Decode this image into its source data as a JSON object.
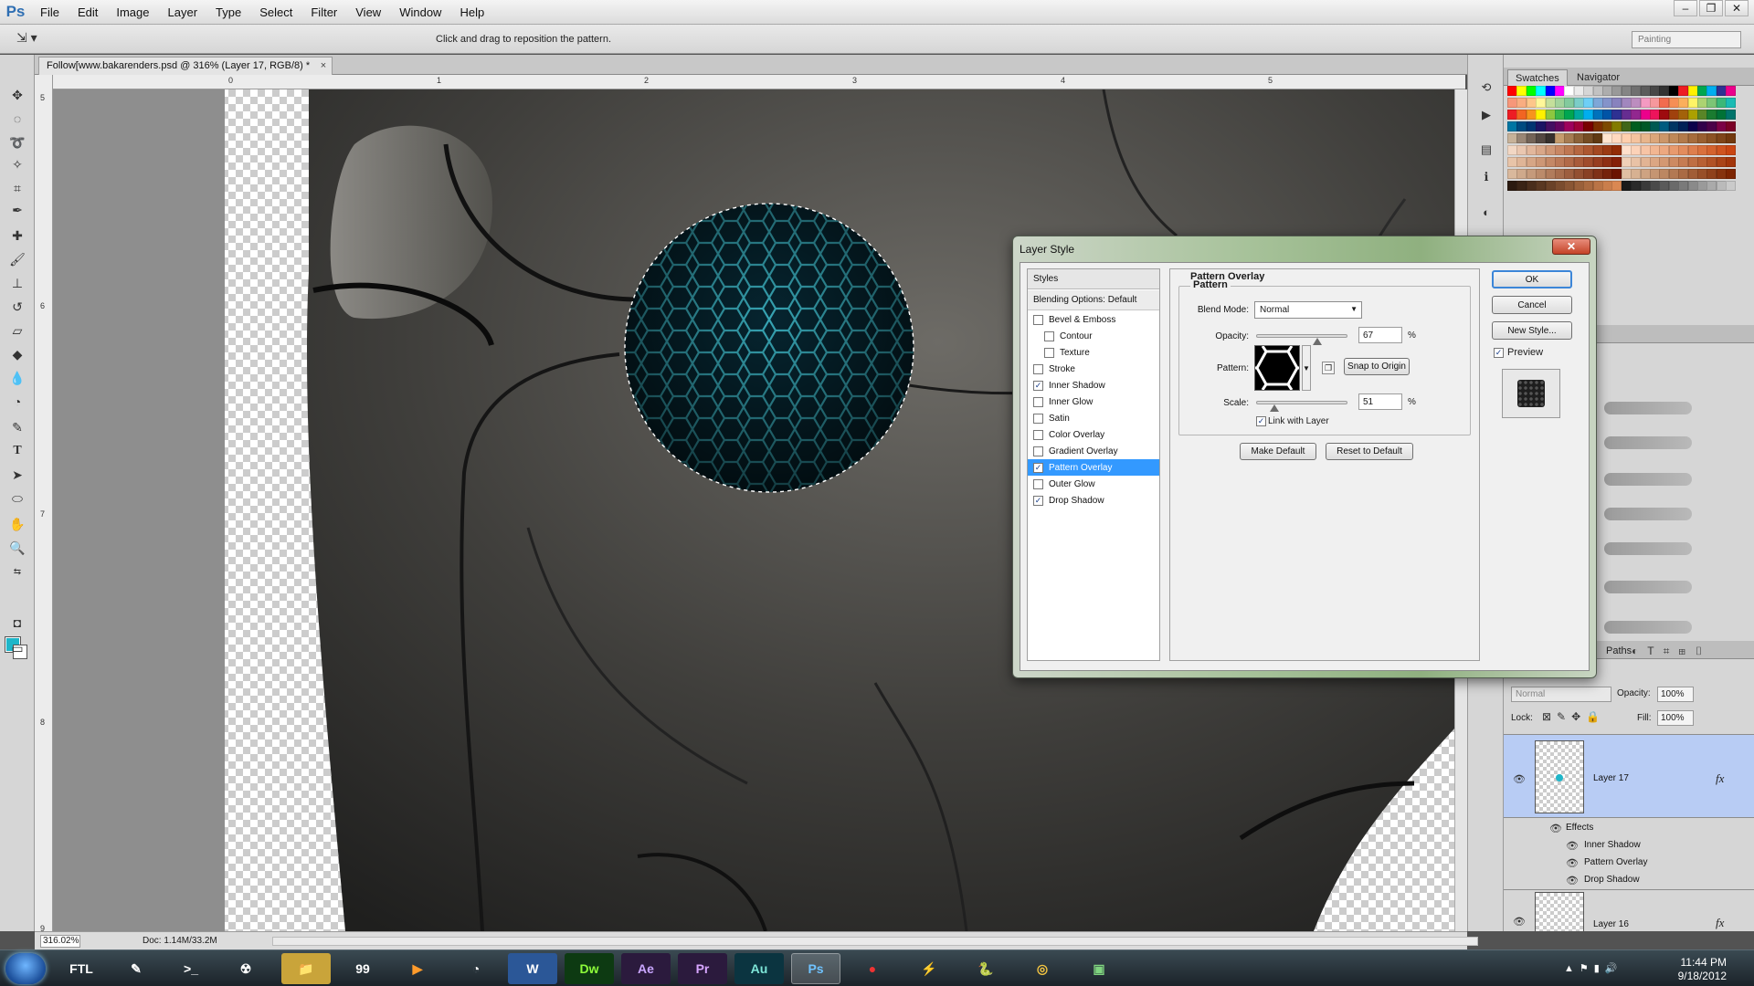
{
  "app": {
    "logo": "Ps",
    "menu": [
      "File",
      "Edit",
      "Image",
      "Layer",
      "Type",
      "Select",
      "Filter",
      "View",
      "Window",
      "Help"
    ]
  },
  "options_bar": {
    "hint": "Click and drag to reposition the pattern.",
    "workspace": "Painting"
  },
  "document": {
    "tab_title": "Follow[www.bakarenders.psd @ 316% (Layer 17, RGB/8) *",
    "tab_close": "×",
    "ruler_top": [
      "0",
      "1",
      "2",
      "3",
      "4",
      "5"
    ],
    "ruler_left": [
      "5",
      "6",
      "7",
      "8",
      "9"
    ],
    "zoom": "316.02%",
    "doc_size": "Doc: 1.14M/33.2M"
  },
  "panels": {
    "swatches_tab": "Swatches",
    "navigator_tab": "Navigator",
    "paths_tab": "Paths",
    "layers": {
      "blend_mode": "Normal",
      "opacity_label": "Opacity:",
      "opacity": "100%",
      "lock_label": "Lock:",
      "fill_label": "Fill:",
      "fill": "100%",
      "items": [
        {
          "name": "Layer 17",
          "fx": "fx"
        },
        {
          "name": "Layer 16",
          "fx": "fx"
        }
      ],
      "effects_label": "Effects",
      "effects": [
        "Inner Shadow",
        "Pattern Overlay",
        "Drop Shadow"
      ]
    }
  },
  "dialog": {
    "title": "Layer Style",
    "close": "✕",
    "styles_header": "Styles",
    "blending_options": "Blending Options: Default",
    "styles": [
      {
        "label": "Bevel & Emboss",
        "checked": false,
        "indent": false
      },
      {
        "label": "Contour",
        "checked": false,
        "indent": true
      },
      {
        "label": "Texture",
        "checked": false,
        "indent": true
      },
      {
        "label": "Stroke",
        "checked": false,
        "indent": false
      },
      {
        "label": "Inner Shadow",
        "checked": true,
        "indent": false
      },
      {
        "label": "Inner Glow",
        "checked": false,
        "indent": false
      },
      {
        "label": "Satin",
        "checked": false,
        "indent": false
      },
      {
        "label": "Color Overlay",
        "checked": false,
        "indent": false
      },
      {
        "label": "Gradient Overlay",
        "checked": false,
        "indent": false
      },
      {
        "label": "Pattern Overlay",
        "checked": true,
        "indent": false,
        "selected": true
      },
      {
        "label": "Outer Glow",
        "checked": false,
        "indent": false
      },
      {
        "label": "Drop Shadow",
        "checked": true,
        "indent": false
      }
    ],
    "section_title": "Pattern Overlay",
    "group_title": "Pattern",
    "blend_mode_label": "Blend Mode:",
    "blend_mode": "Normal",
    "opacity_label": "Opacity:",
    "opacity": "67",
    "opacity_fraction": 0.67,
    "pattern_label": "Pattern:",
    "snap_to_origin": "Snap to Origin",
    "scale_label": "Scale:",
    "scale": "51",
    "scale_fraction": 0.051,
    "percent": "%",
    "link_with_layer": "Link with Layer",
    "link_checked": true,
    "make_default": "Make Default",
    "reset_to_default": "Reset to Default",
    "ok": "OK",
    "cancel": "Cancel",
    "new_style": "New Style...",
    "preview": "Preview",
    "preview_checked": true
  },
  "taskbar": {
    "apps": [
      "FTL",
      "✎",
      ">_",
      "☢",
      "📁",
      "99",
      "▶",
      "◔",
      "W",
      "Dw",
      "Ae",
      "Pr",
      "Au",
      "Ps",
      "●",
      "⚡",
      "🐍",
      "◎",
      "▣"
    ],
    "time": "11:44 PM",
    "date": "9/18/2012"
  },
  "colors": {
    "foreground": "#1fb6c9",
    "background": "#ffffff",
    "selection": "#3399ff",
    "layer_selected": "#b8ccf4"
  }
}
